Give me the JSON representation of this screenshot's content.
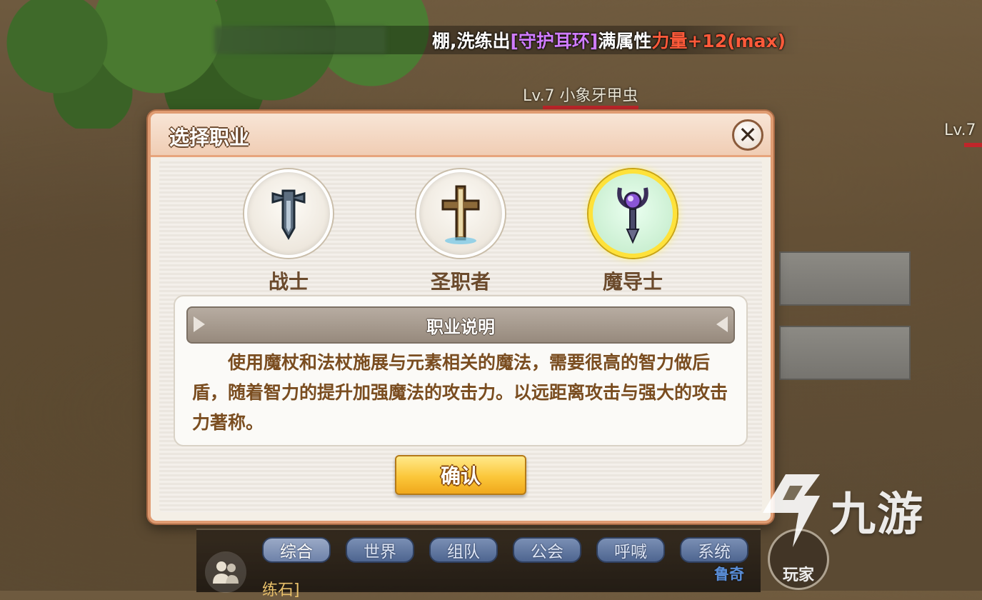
{
  "system_message": {
    "prefix": "棚,洗练出",
    "item": "[守护耳环]",
    "middle": "满属性",
    "stat": "力量+12(max)"
  },
  "mobs": [
    {
      "label": "Lv.7  小象牙甲虫"
    },
    {
      "label": "Lv.7"
    }
  ],
  "dialog": {
    "title": "选择职业",
    "close_symbol": "✕",
    "classes": [
      {
        "name": "战士",
        "icon": "sword-icon",
        "selected": false
      },
      {
        "name": "圣职者",
        "icon": "cross-icon",
        "selected": false
      },
      {
        "name": "魔导士",
        "icon": "staff-icon",
        "selected": true
      }
    ],
    "description_title": "职业说明",
    "description_text": "使用魔杖和法杖施展与元素相关的魔法，需要很高的智力做后盾，随着智力的提升加强魔法的攻击力。以远距离攻击与强大的攻击力著称。",
    "confirm_label": "确认"
  },
  "chat": {
    "tabs": [
      "综合",
      "世界",
      "组队",
      "公会",
      "呼喊",
      "系统"
    ],
    "active_tab": 0,
    "line": "练石]"
  },
  "player": {
    "name": "鲁奇",
    "button_label": "玩家"
  },
  "watermark": {
    "text": "九游"
  },
  "colors": {
    "item_purple": "#d07cff",
    "stat_red": "#ff5a3a",
    "selected_ring": "#ffe23a",
    "confirm_gold": "#fbc73a"
  }
}
